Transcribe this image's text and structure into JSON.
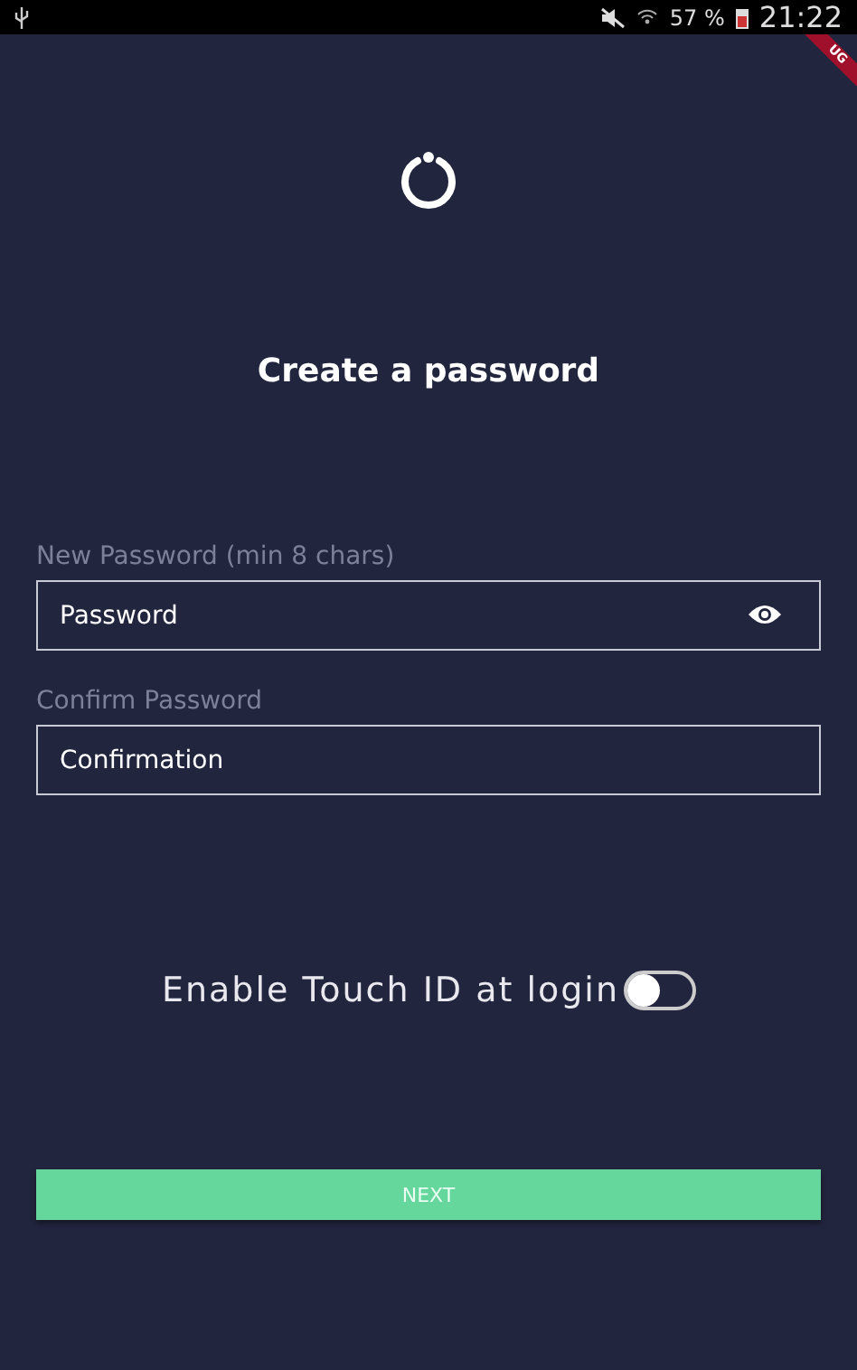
{
  "status_bar": {
    "battery": "57 %",
    "time": "21:22"
  },
  "debug_banner": "UG",
  "title": "Create a password",
  "fields": [
    {
      "label": "New Password (min 8 chars)",
      "placeholder": "Password",
      "reveal_icon": true
    },
    {
      "label": "Confirm Password",
      "placeholder": "Confirmation",
      "reveal_icon": false
    }
  ],
  "touch_id": {
    "label": "Enable Touch ID at login",
    "on": false
  },
  "next_button": {
    "label": "NEXT"
  }
}
